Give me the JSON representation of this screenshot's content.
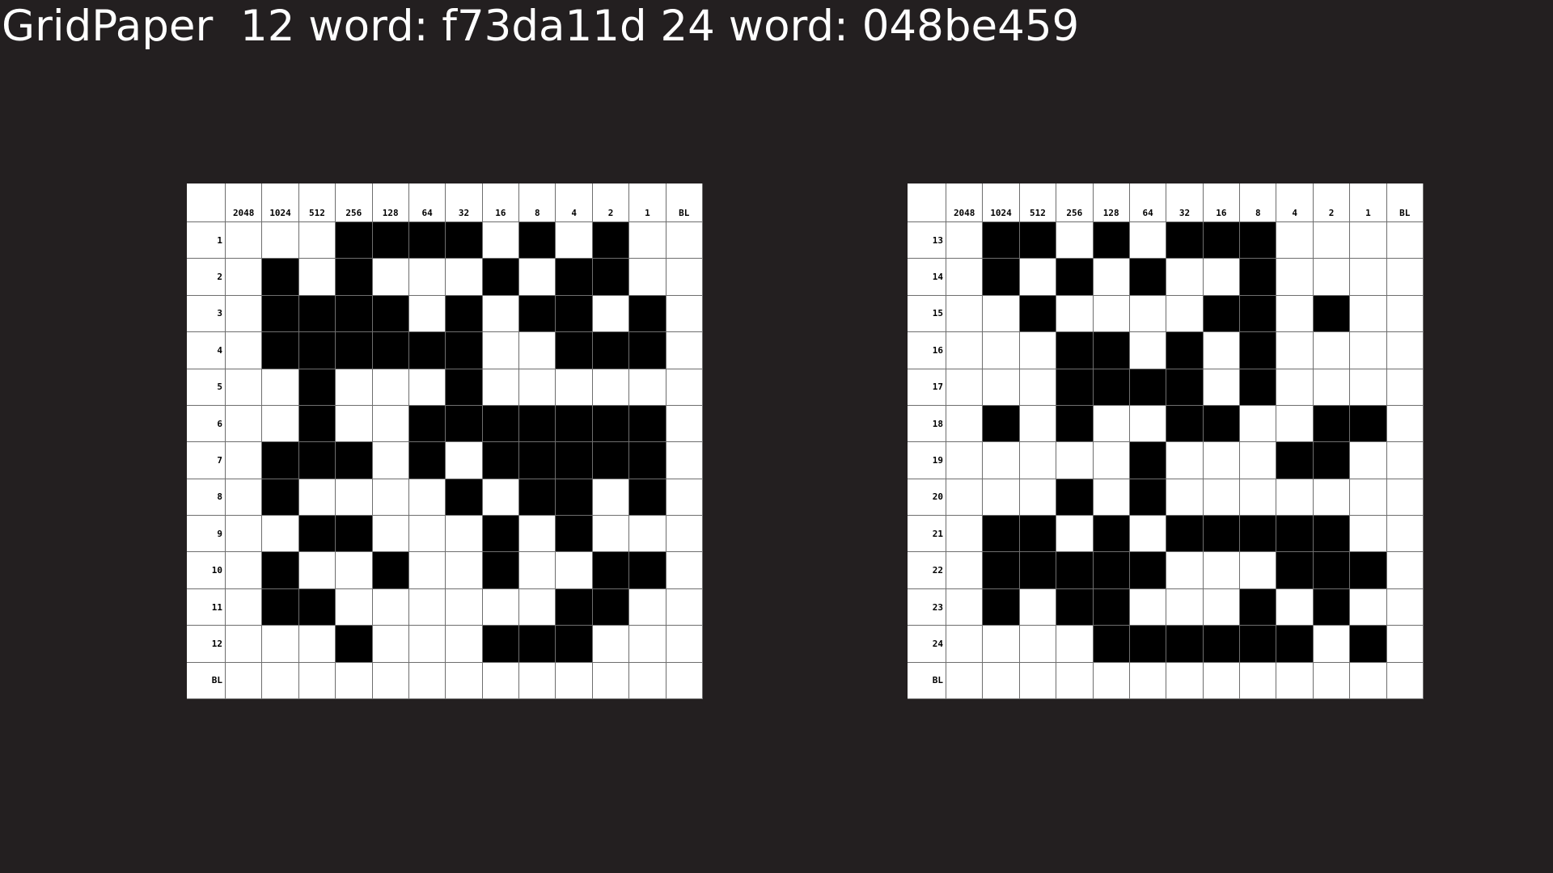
{
  "title": "GridPaper  12 word: f73da11d 24 word: 048be459",
  "column_headers": [
    "2048",
    "1024",
    "512",
    "256",
    "128",
    "64",
    "32",
    "16",
    "8",
    "4",
    "2",
    "1",
    "BL"
  ],
  "grids": [
    {
      "row_labels": [
        "1",
        "2",
        "3",
        "4",
        "5",
        "6",
        "7",
        "8",
        "9",
        "10",
        "11",
        "12",
        "BL"
      ],
      "rows": [
        "0001111010100",
        "0101000101100",
        "0111101011010",
        "0111111001110",
        "0010001000000",
        "0010011111110",
        "0111010111110",
        "0100001011010",
        "0011000101000",
        "0100100100110",
        "0110000001100",
        "0001000111000",
        "0000000000000"
      ]
    },
    {
      "row_labels": [
        "13",
        "14",
        "15",
        "16",
        "17",
        "18",
        "19",
        "20",
        "21",
        "22",
        "23",
        "24",
        "BL"
      ],
      "rows": [
        "0110101110000",
        "0101010010000",
        "0010000110100",
        "0001101010000",
        "0001111010000",
        "0101001100110",
        "0000010001100",
        "0001010000000",
        "0110101111100",
        "0111110001110",
        "0101100010100",
        "0000111111010",
        "0000000000000"
      ]
    }
  ]
}
